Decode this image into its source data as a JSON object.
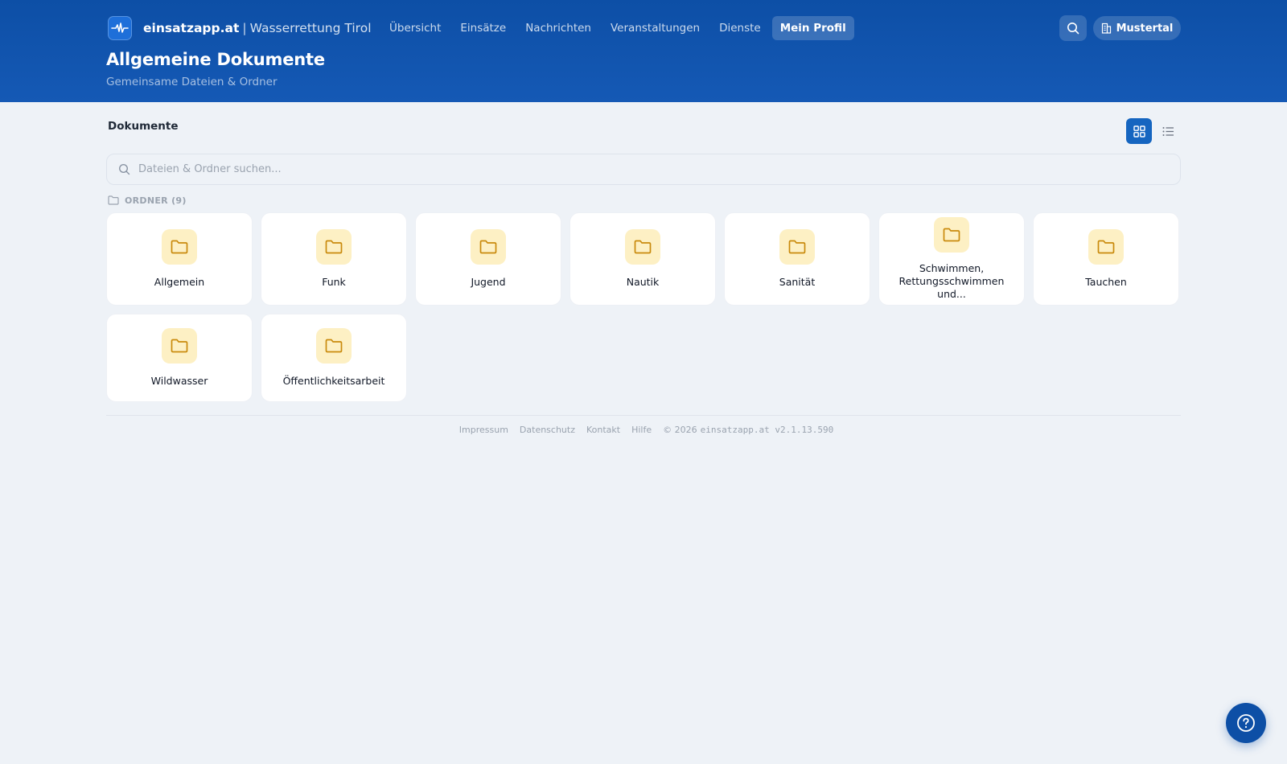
{
  "header": {
    "brand_name": "einsatzapp.at",
    "brand_separator": "|",
    "brand_org": "Wasserrettung Tirol",
    "nav": [
      {
        "label": "Übersicht"
      },
      {
        "label": "Einsätze"
      },
      {
        "label": "Nachrichten"
      },
      {
        "label": "Veranstaltungen"
      },
      {
        "label": "Dienste"
      },
      {
        "label": "Mein Profil",
        "active": true
      }
    ],
    "org_button_label": "Mustertal",
    "page_title": "Allgemeine Dokumente",
    "page_subtitle": "Gemeinsame Dateien & Ordner"
  },
  "main": {
    "section_label": "Dokumente",
    "view_mode": "grid",
    "search": {
      "placeholder": "Dateien & Ordner suchen...",
      "value": ""
    },
    "folders_heading": "ORDNER (9)",
    "folders": [
      {
        "name": "Allgemein"
      },
      {
        "name": "Funk"
      },
      {
        "name": "Jugend"
      },
      {
        "name": "Nautik"
      },
      {
        "name": "Sanität"
      },
      {
        "name_line1": "Schwimmen,",
        "name_line2": "Rettungsschwimmen und..."
      },
      {
        "name": "Tauchen"
      },
      {
        "name": "Wildwasser"
      },
      {
        "name": "Öffentlichkeitsarbeit"
      }
    ]
  },
  "footer": {
    "links": [
      "Impressum",
      "Datenschutz",
      "Kontakt",
      "Hilfe"
    ],
    "copyright": "© 2026",
    "version": "einsatzapp.at v2.1.13.590"
  },
  "colors": {
    "header_bg": "#0d4fa6",
    "accent": "#1565c0",
    "folder_badge": "#fdf0c4",
    "folder_icon": "#c98a0c",
    "page_bg": "#eef2f7"
  },
  "icons": {
    "brand": "pulse-icon",
    "search": "search-icon",
    "org": "building-icon",
    "grid_view": "grid-icon",
    "list_view": "list-icon",
    "folder": "folder-icon",
    "help": "help-icon"
  }
}
